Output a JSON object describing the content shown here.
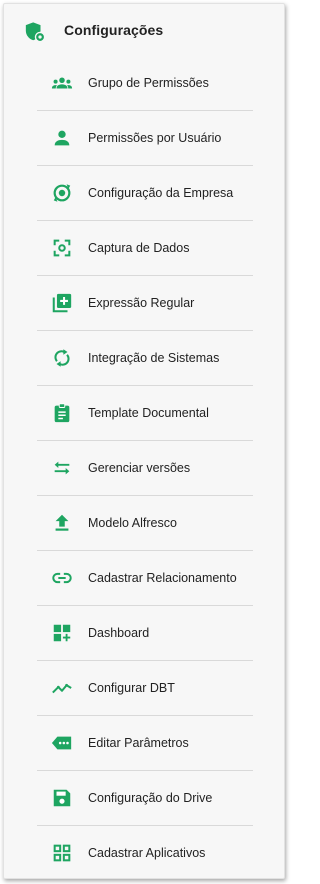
{
  "accent_color": "#1ea561",
  "header": {
    "title": "Configurações",
    "icon": "shield-settings-icon"
  },
  "menu": {
    "items": [
      {
        "label": "Grupo de Permissões",
        "icon": "group-icon"
      },
      {
        "label": "Permissões por Usuário",
        "icon": "person-icon"
      },
      {
        "label": "Configuração da Empresa",
        "icon": "settings-sync-icon"
      },
      {
        "label": "Captura de Dados",
        "icon": "center-focus-icon"
      },
      {
        "label": "Expressão Regular",
        "icon": "library-add-icon"
      },
      {
        "label": "Integração de Sistemas",
        "icon": "sync-icon"
      },
      {
        "label": "Template Documental",
        "icon": "clipboard-icon"
      },
      {
        "label": "Gerenciar versões",
        "icon": "swap-arrows-icon"
      },
      {
        "label": "Modelo Alfresco",
        "icon": "upload-icon"
      },
      {
        "label": "Cadastrar Relacionamento",
        "icon": "link-icon"
      },
      {
        "label": "Dashboard",
        "icon": "dashboard-add-icon"
      },
      {
        "label": "Configurar DBT",
        "icon": "trending-icon"
      },
      {
        "label": "Editar Parâmetros",
        "icon": "tag-more-icon"
      },
      {
        "label": "Configuração do Drive",
        "icon": "save-icon"
      },
      {
        "label": "Cadastrar Aplicativos",
        "icon": "apps-grid-icon"
      }
    ]
  }
}
